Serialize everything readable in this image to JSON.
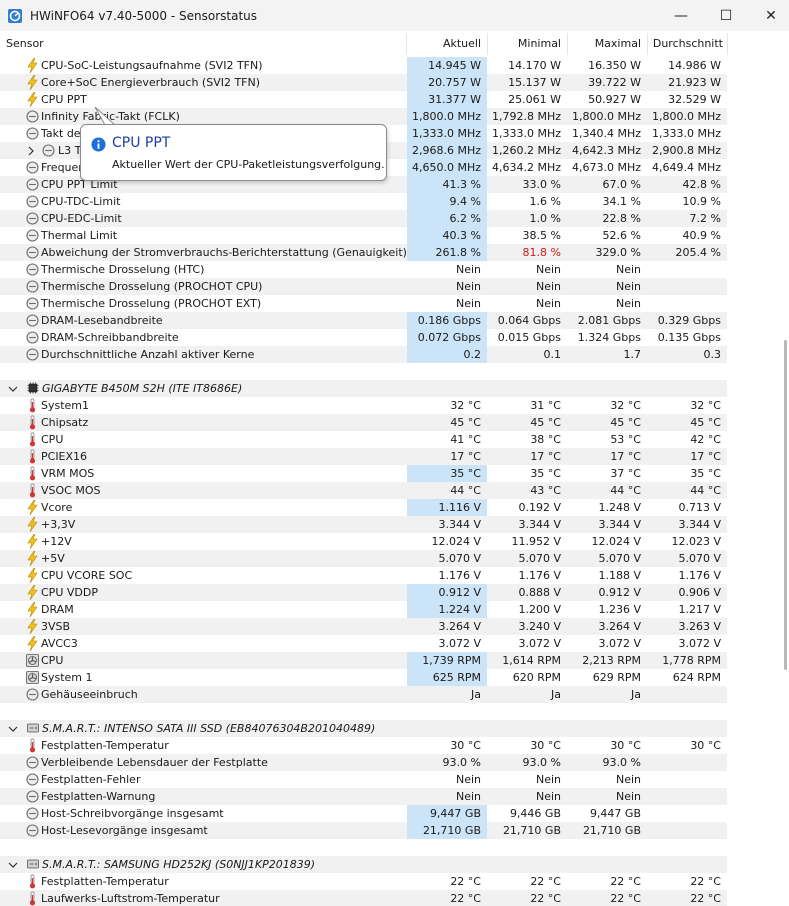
{
  "window": {
    "title": "HWiNFO64 v7.40-5000 - Sensorstatus",
    "controls": {
      "minimize": "—",
      "maximize": "☐",
      "close": "✕"
    }
  },
  "columns": {
    "sensor": "Sensor",
    "current": "Aktuell",
    "min": "Minimal",
    "max": "Maximal",
    "avg": "Durchschnitt"
  },
  "tooltip": {
    "title": "CPU PPT",
    "text": "Aktueller Wert der CPU-Paketleistungsverfolgung."
  },
  "rows": [
    {
      "type": "sensor",
      "icon": "lightning-icon",
      "name": "CPU-SoC-Leistungsaufnahme (SVI2 TFN)",
      "current": "14.945 W",
      "min": "14.170 W",
      "max": "16.350 W",
      "avg": "14.986 W",
      "hl": true
    },
    {
      "type": "sensor",
      "icon": "lightning-icon",
      "name": "Core+SoC Energieverbrauch (SVI2 TFN)",
      "current": "20.757 W",
      "min": "15.137 W",
      "max": "39.722 W",
      "avg": "21.923 W",
      "hl": true
    },
    {
      "type": "sensor",
      "icon": "lightning-icon",
      "name": "CPU PPT",
      "current": "31.377 W",
      "min": "25.061 W",
      "max": "50.927 W",
      "avg": "32.529 W",
      "hl": true
    },
    {
      "type": "sensor",
      "icon": "clock-icon",
      "name": "Infinity Fabric-Takt (FCLK)",
      "current": "1,800.0 MHz",
      "min": "1,792.8 MHz",
      "max": "1,800.0 MHz",
      "avg": "1,800.0 MHz",
      "hl": true
    },
    {
      "type": "sensor",
      "icon": "clock-icon",
      "name": "Takt des Speichercontrollers",
      "current": "1,333.0 MHz",
      "min": "1,333.0 MHz",
      "max": "1,340.4 MHz",
      "avg": "1,333.0 MHz",
      "hl": true
    },
    {
      "type": "sensor",
      "icon": "clock-icon",
      "expand": true,
      "name": "L3 Takte",
      "current": "2,968.6 MHz",
      "min": "1,260.2 MHz",
      "max": "4,642.3 MHz",
      "avg": "2,900.8 MHz",
      "hl": true
    },
    {
      "type": "sensor",
      "icon": "clock-icon",
      "name": "Frequenz-Limit",
      "current": "4,650.0 MHz",
      "min": "4,634.2 MHz",
      "max": "4,673.0 MHz",
      "avg": "4,649.4 MHz",
      "hl": true
    },
    {
      "type": "sensor",
      "icon": "clock-icon",
      "name": "CPU PPT Limit",
      "current": "41.3 %",
      "min": "33.0 %",
      "max": "67.0 %",
      "avg": "42.8 %",
      "hl": true
    },
    {
      "type": "sensor",
      "icon": "clock-icon",
      "name": "CPU-TDC-Limit",
      "current": "9.4 %",
      "min": "1.6 %",
      "max": "34.1 %",
      "avg": "10.9 %",
      "hl": true
    },
    {
      "type": "sensor",
      "icon": "clock-icon",
      "name": "CPU-EDC-Limit",
      "current": "6.2 %",
      "min": "1.0 %",
      "max": "22.8 %",
      "avg": "7.2 %",
      "hl": true
    },
    {
      "type": "sensor",
      "icon": "clock-icon",
      "name": "Thermal Limit",
      "current": "40.3 %",
      "min": "38.5 %",
      "max": "52.6 %",
      "avg": "40.9 %",
      "hl": true
    },
    {
      "type": "sensor",
      "icon": "clock-icon",
      "name": "Abweichung der Stromverbrauchs-Berichterstattung (Genauigkeit)",
      "current": "261.8 %",
      "min": "81.8 %",
      "max": "329.0 %",
      "avg": "205.4 %",
      "hl": true,
      "minRed": true
    },
    {
      "type": "sensor",
      "icon": "clock-icon",
      "name": "Thermische Drosselung (HTC)",
      "current": "Nein",
      "min": "Nein",
      "max": "Nein",
      "avg": ""
    },
    {
      "type": "sensor",
      "icon": "clock-icon",
      "name": "Thermische Drosselung (PROCHOT CPU)",
      "current": "Nein",
      "min": "Nein",
      "max": "Nein",
      "avg": ""
    },
    {
      "type": "sensor",
      "icon": "clock-icon",
      "name": "Thermische Drosselung (PROCHOT EXT)",
      "current": "Nein",
      "min": "Nein",
      "max": "Nein",
      "avg": ""
    },
    {
      "type": "sensor",
      "icon": "clock-icon",
      "name": "DRAM-Lesebandbreite",
      "current": "0.186 Gbps",
      "min": "0.064 Gbps",
      "max": "2.081 Gbps",
      "avg": "0.329 Gbps",
      "hl": true
    },
    {
      "type": "sensor",
      "icon": "clock-icon",
      "name": "DRAM-Schreibbandbreite",
      "current": "0.072 Gbps",
      "min": "0.015 Gbps",
      "max": "1.324 Gbps",
      "avg": "0.135 Gbps",
      "hl": true
    },
    {
      "type": "sensor",
      "icon": "clock-icon",
      "name": "Durchschnittliche Anzahl aktiver Kerne",
      "current": "0.2",
      "min": "0.1",
      "max": "1.7",
      "avg": "0.3",
      "hl": true
    },
    {
      "type": "blank"
    },
    {
      "type": "group",
      "icon": "chip-icon",
      "name": "GIGABYTE B450M S2H (ITE IT8686E)"
    },
    {
      "type": "sensor",
      "icon": "thermometer-icon",
      "name": "System1",
      "current": "32 °C",
      "min": "31 °C",
      "max": "32 °C",
      "avg": "32 °C"
    },
    {
      "type": "sensor",
      "icon": "thermometer-icon",
      "name": "Chipsatz",
      "current": "45 °C",
      "min": "45 °C",
      "max": "45 °C",
      "avg": "45 °C"
    },
    {
      "type": "sensor",
      "icon": "thermometer-icon",
      "name": "CPU",
      "current": "41 °C",
      "min": "38 °C",
      "max": "53 °C",
      "avg": "42 °C"
    },
    {
      "type": "sensor",
      "icon": "thermometer-icon",
      "name": "PCIEX16",
      "current": "17 °C",
      "min": "17 °C",
      "max": "17 °C",
      "avg": "17 °C"
    },
    {
      "type": "sensor",
      "icon": "thermometer-icon",
      "name": "VRM MOS",
      "current": "35 °C",
      "min": "35 °C",
      "max": "37 °C",
      "avg": "35 °C",
      "hl": true
    },
    {
      "type": "sensor",
      "icon": "thermometer-icon",
      "name": "VSOC MOS",
      "current": "44 °C",
      "min": "43 °C",
      "max": "44 °C",
      "avg": "44 °C"
    },
    {
      "type": "sensor",
      "icon": "lightning-icon",
      "name": "Vcore",
      "current": "1.116 V",
      "min": "0.192 V",
      "max": "1.248 V",
      "avg": "0.713 V",
      "hl": true
    },
    {
      "type": "sensor",
      "icon": "lightning-icon",
      "name": "+3,3V",
      "current": "3.344 V",
      "min": "3.344 V",
      "max": "3.344 V",
      "avg": "3.344 V"
    },
    {
      "type": "sensor",
      "icon": "lightning-icon",
      "name": "+12V",
      "current": "12.024 V",
      "min": "11.952 V",
      "max": "12.024 V",
      "avg": "12.023 V"
    },
    {
      "type": "sensor",
      "icon": "lightning-icon",
      "name": "+5V",
      "current": "5.070 V",
      "min": "5.070 V",
      "max": "5.070 V",
      "avg": "5.070 V"
    },
    {
      "type": "sensor",
      "icon": "lightning-icon",
      "name": "CPU VCORE SOC",
      "current": "1.176 V",
      "min": "1.176 V",
      "max": "1.188 V",
      "avg": "1.176 V"
    },
    {
      "type": "sensor",
      "icon": "lightning-icon",
      "name": "CPU VDDP",
      "current": "0.912 V",
      "min": "0.888 V",
      "max": "0.912 V",
      "avg": "0.906 V",
      "hl": true
    },
    {
      "type": "sensor",
      "icon": "lightning-icon",
      "name": "DRAM",
      "current": "1.224 V",
      "min": "1.200 V",
      "max": "1.236 V",
      "avg": "1.217 V",
      "hl": true
    },
    {
      "type": "sensor",
      "icon": "lightning-icon",
      "name": "3VSB",
      "current": "3.264 V",
      "min": "3.240 V",
      "max": "3.264 V",
      "avg": "3.263 V"
    },
    {
      "type": "sensor",
      "icon": "lightning-icon",
      "name": "AVCC3",
      "current": "3.072 V",
      "min": "3.072 V",
      "max": "3.072 V",
      "avg": "3.072 V"
    },
    {
      "type": "sensor",
      "icon": "fan-icon",
      "name": "CPU",
      "current": "1,739 RPM",
      "min": "1,614 RPM",
      "max": "2,213 RPM",
      "avg": "1,778 RPM",
      "hl": true
    },
    {
      "type": "sensor",
      "icon": "fan-icon",
      "name": "System 1",
      "current": "625 RPM",
      "min": "620 RPM",
      "max": "629 RPM",
      "avg": "624 RPM",
      "hl": true
    },
    {
      "type": "sensor",
      "icon": "clock-icon",
      "name": "Gehäuseeinbruch",
      "current": "Ja",
      "min": "Ja",
      "max": "Ja",
      "avg": ""
    },
    {
      "type": "blank"
    },
    {
      "type": "group",
      "icon": "drive-icon",
      "name": "S.M.A.R.T.: INTENSO SATA III SSD (EB84076304B201040489)"
    },
    {
      "type": "sensor",
      "icon": "thermometer-icon",
      "name": "Festplatten-Temperatur",
      "current": "30 °C",
      "min": "30 °C",
      "max": "30 °C",
      "avg": "30 °C"
    },
    {
      "type": "sensor",
      "icon": "clock-icon",
      "name": "Verbleibende Lebensdauer der Festplatte",
      "current": "93.0 %",
      "min": "93.0 %",
      "max": "93.0 %",
      "avg": ""
    },
    {
      "type": "sensor",
      "icon": "clock-icon",
      "name": "Festplatten-Fehler",
      "current": "Nein",
      "min": "Nein",
      "max": "Nein",
      "avg": ""
    },
    {
      "type": "sensor",
      "icon": "clock-icon",
      "name": "Festplatten-Warnung",
      "current": "Nein",
      "min": "Nein",
      "max": "Nein",
      "avg": ""
    },
    {
      "type": "sensor",
      "icon": "clock-icon",
      "name": "Host-Schreibvorgänge insgesamt",
      "current": "9,447 GB",
      "min": "9,446 GB",
      "max": "9,447 GB",
      "avg": "",
      "hl": true
    },
    {
      "type": "sensor",
      "icon": "clock-icon",
      "name": "Host-Lesevorgänge insgesamt",
      "current": "21,710 GB",
      "min": "21,710 GB",
      "max": "21,710 GB",
      "avg": "",
      "hl": true
    },
    {
      "type": "blank"
    },
    {
      "type": "group",
      "icon": "drive-icon",
      "name": "S.M.A.R.T.: SAMSUNG HD252KJ (S0NJJ1KP201839)"
    },
    {
      "type": "sensor",
      "icon": "thermometer-icon",
      "name": "Festplatten-Temperatur",
      "current": "22 °C",
      "min": "22 °C",
      "max": "22 °C",
      "avg": "22 °C"
    },
    {
      "type": "sensor",
      "icon": "thermometer-icon",
      "name": "Laufwerks-Luftstrom-Temperatur",
      "current": "22 °C",
      "min": "22 °C",
      "max": "22 °C",
      "avg": "22 °C"
    }
  ]
}
